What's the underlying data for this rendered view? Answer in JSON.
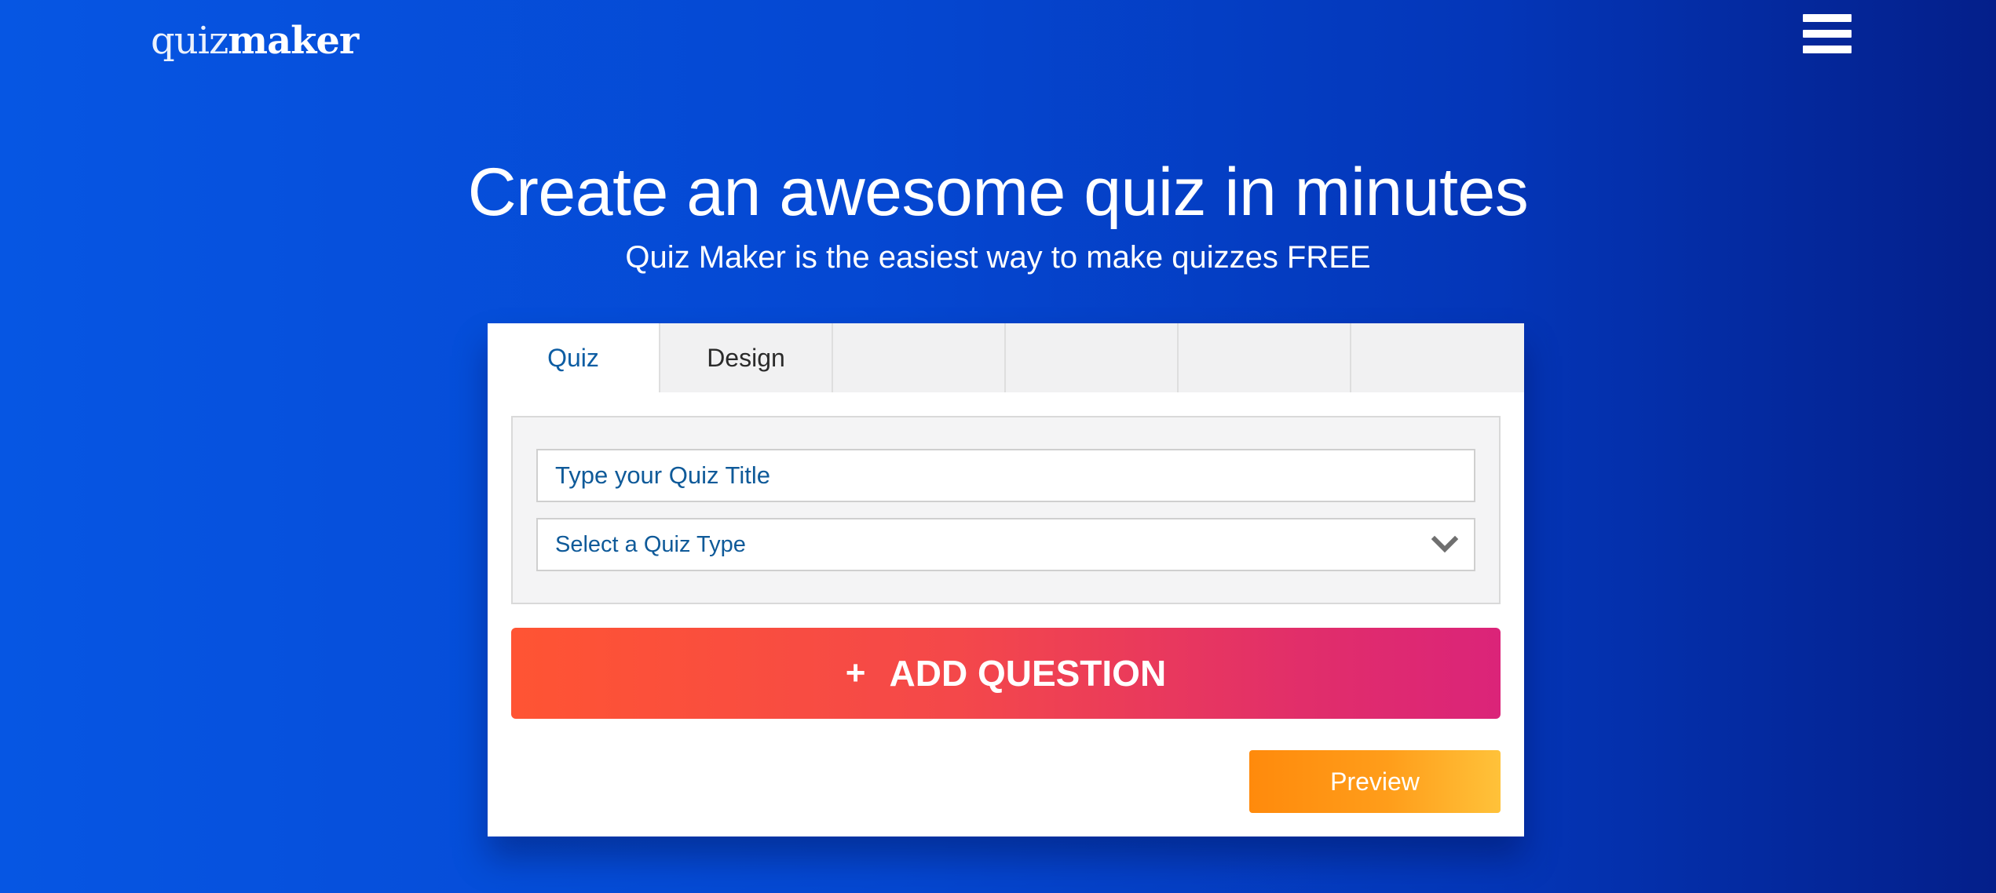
{
  "header": {
    "logo_light": "quiz",
    "logo_bold": "maker",
    "menu_icon": "hamburger-menu-icon"
  },
  "hero": {
    "title": "Create an awesome quiz in minutes",
    "subtitle": "Quiz Maker is the easiest way to make quizzes FREE"
  },
  "tabs": [
    {
      "label": "Quiz",
      "active": true
    },
    {
      "label": "Design",
      "active": false
    },
    {
      "label": "",
      "active": false
    },
    {
      "label": "",
      "active": false
    },
    {
      "label": "",
      "active": false
    },
    {
      "label": "",
      "active": false
    }
  ],
  "form": {
    "title_placeholder": "Type your Quiz Title",
    "title_value": "",
    "quiz_type_selected": "Select a Quiz Type",
    "quiz_type_icon": "chevron-down-icon"
  },
  "actions": {
    "add_question_icon": "+",
    "add_question_label": "ADD QUESTION",
    "preview_label": "Preview"
  },
  "colors": {
    "background_start": "#0656e3",
    "background_end": "#041f8a",
    "tab_active_text": "#0d5da3",
    "add_question_start": "#ff5433",
    "add_question_end": "#db2479",
    "preview_start": "#ff8a0c",
    "preview_end": "#ffc23a"
  }
}
